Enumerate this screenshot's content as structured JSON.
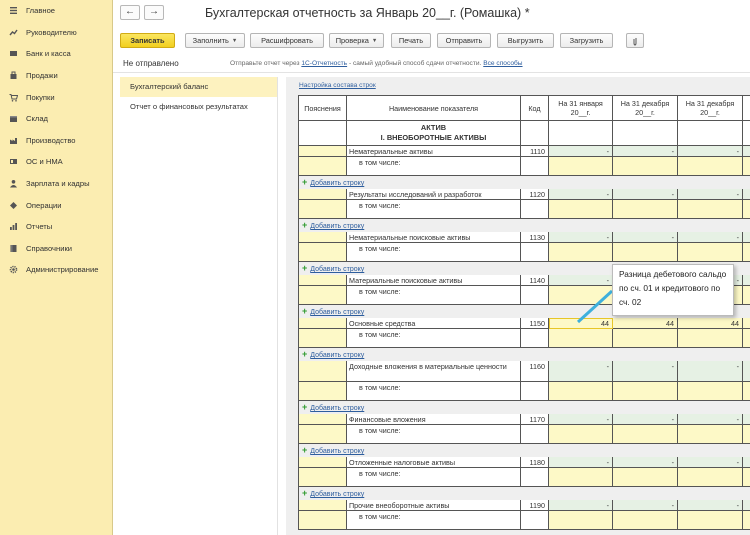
{
  "sidebar": {
    "items": [
      {
        "label": "Главное",
        "icon": "menu-icon"
      },
      {
        "label": "Руководителю",
        "icon": "trend-icon"
      },
      {
        "label": "Банк и касса",
        "icon": "bank-icon"
      },
      {
        "label": "Продажи",
        "icon": "bag-icon"
      },
      {
        "label": "Покупки",
        "icon": "cart-icon"
      },
      {
        "label": "Склад",
        "icon": "box-icon"
      },
      {
        "label": "Производство",
        "icon": "factory-icon"
      },
      {
        "label": "ОС и НМА",
        "icon": "assets-icon"
      },
      {
        "label": "Зарплата и кадры",
        "icon": "people-icon"
      },
      {
        "label": "Операции",
        "icon": "operations-icon"
      },
      {
        "label": "Отчеты",
        "icon": "chart-icon"
      },
      {
        "label": "Справочники",
        "icon": "book-icon"
      },
      {
        "label": "Администрирование",
        "icon": "gear-icon"
      }
    ]
  },
  "topbar": {
    "back": "←",
    "forward": "→",
    "title": "Бухгалтерская отчетность за Январь 20__г. (Ромашка) *"
  },
  "toolbar": {
    "record": "Записать",
    "fill": "Заполнить",
    "decode": "Расшифровать",
    "check": "Проверка",
    "print": "Печать",
    "send": "Отправить",
    "export": "Выгрузить",
    "load": "Загрузить",
    "attach_icon": "paperclip-icon"
  },
  "status": {
    "text": "Не отправлено",
    "hint_prefix": "Отправьте отчет через",
    "hint_link": "1С-Отчетность",
    "hint_middle": "- самый удобный способ сдачи отчетности.",
    "hint_link2": "Все способы"
  },
  "sections": [
    "Бухгалтерский баланс",
    "Отчет о финансовых результатах"
  ],
  "doc": {
    "settings_link": "Настройка состава строк",
    "add_row": "Добавить строку",
    "in_that": "в том числе:",
    "headers": {
      "notes": "Пояснения",
      "name": "Наименование показателя",
      "code": "Код",
      "col1": "На 31 января 20__г.",
      "col2": "На 31 декабря 20__г.",
      "col3": "На 31 декабря 20__г."
    },
    "aktiv": "АКТИВ",
    "section1": "I. ВНЕОБОРОТНЫЕ АКТИВЫ",
    "first": {
      "name": "Нематериальные активы",
      "code": "1110",
      "v1": "-",
      "v2": "-",
      "v3": "-"
    },
    "blocks": [
      {
        "name": "Результаты исследований и разработок",
        "code": "1120",
        "v1": "-",
        "v2": "-",
        "v3": "-"
      },
      {
        "name": "Нематериальные поисковые активы",
        "code": "1130",
        "v1": "-",
        "v2": "-",
        "v3": "-"
      },
      {
        "name": "Материальные поисковые активы",
        "code": "1140",
        "v1": "-",
        "v2": "-",
        "v3": "-"
      },
      {
        "name": "Основные средства",
        "code": "1150",
        "v1": "44",
        "v2": "44",
        "v3": "44"
      },
      {
        "name": "Доходные вложения в материальные ценности",
        "code": "1160",
        "v1": "-",
        "v2": "-",
        "v3": "-"
      },
      {
        "name": "Финансовые вложения",
        "code": "1170",
        "v1": "-",
        "v2": "-",
        "v3": "-"
      },
      {
        "name": "Отложенные налоговые активы",
        "code": "1180",
        "v1": "-",
        "v2": "-",
        "v3": "-"
      },
      {
        "name": "Прочие внеоборотные активы",
        "code": "1190",
        "v1": "-",
        "v2": "-",
        "v3": "-"
      }
    ]
  },
  "tooltip": {
    "text": "Разница дебетового сальдо по сч. 01 и кредитового по сч. 02"
  }
}
